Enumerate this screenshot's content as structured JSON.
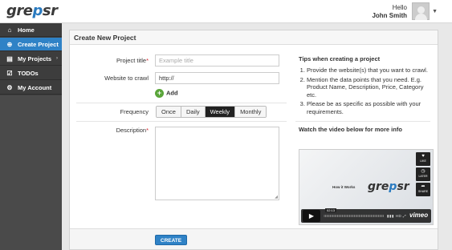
{
  "app": {
    "logo_pre": "gre",
    "logo_p": "p",
    "logo_post": "sr"
  },
  "user": {
    "greeting": "Hello",
    "name": "John Smith"
  },
  "sidebar": {
    "items": [
      {
        "label": "Home",
        "icon": "home-icon"
      },
      {
        "label": "Create Project",
        "icon": "plus-icon"
      },
      {
        "label": "My Projects",
        "icon": "folder-icon",
        "arrow": "›"
      },
      {
        "label": "TODOs",
        "icon": "checklist-icon"
      },
      {
        "label": "My Account",
        "icon": "gear-icon"
      }
    ]
  },
  "form": {
    "heading": "Create New Project",
    "project_title_label": "Project title",
    "project_title_placeholder": "Example title",
    "website_label": "Website to crawl",
    "website_value": "http://",
    "add_label": "Add",
    "frequency_label": "Frequency",
    "frequency_options": [
      "Once",
      "Daily",
      "Weekly",
      "Monthly"
    ],
    "frequency_selected": "Weekly",
    "description_label": "Description",
    "required_mark": "*",
    "create_label": "CREATE"
  },
  "tips": {
    "heading": "Tips when creating a project",
    "items": [
      "Provide the website(s) that you want to crawl.",
      "Mention the data points that you need. E.g. Product Name, Description, Price, Category etc.",
      "Please be as specific as possible with your requirements."
    ],
    "video_heading": "Watch the video below for more info"
  },
  "video": {
    "title_text": "How it Works",
    "logo_pre": "gre",
    "logo_p": "p",
    "logo_post": "sr",
    "side_buttons": [
      "LIKE",
      "LATER",
      "SHARE"
    ],
    "time": "02:13",
    "quality": "HD",
    "brand": "vimeo"
  },
  "colors": {
    "accent": "#2f82c6",
    "sidebar": "#3d3d3d",
    "required": "#d9232e",
    "add_green": "#5aa53a"
  }
}
